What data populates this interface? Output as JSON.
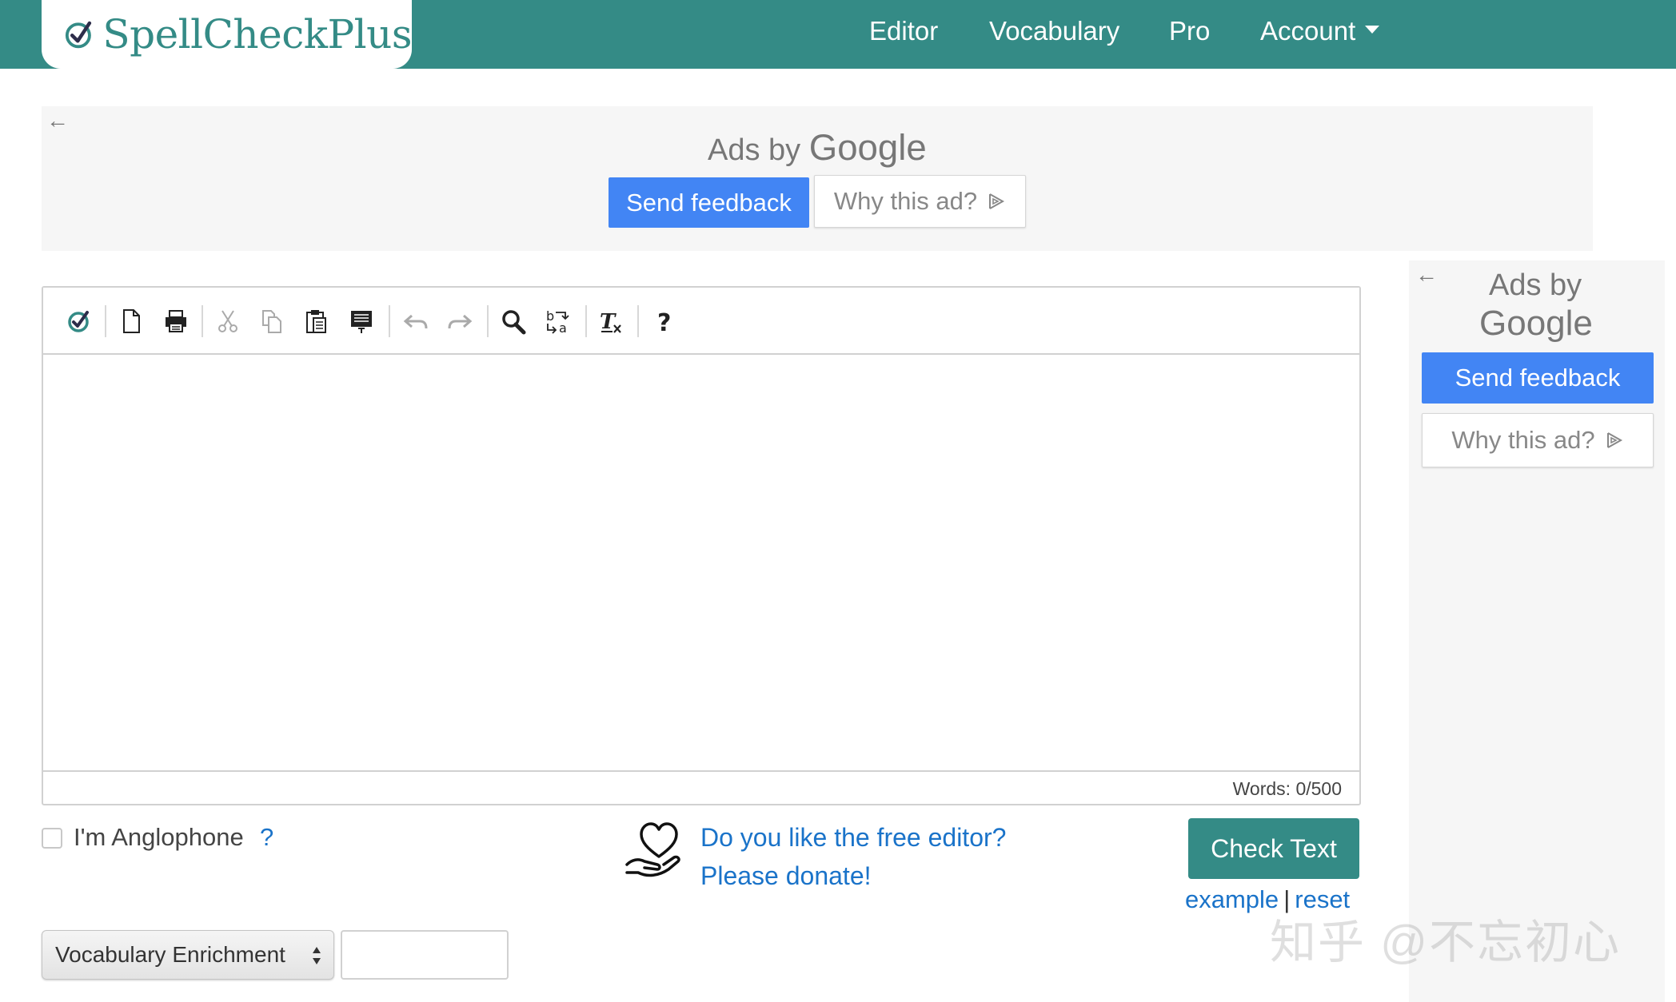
{
  "brand": {
    "name": "SpellCheckPlus",
    "color": "#348b86"
  },
  "nav": {
    "items": [
      "Editor",
      "Vocabulary",
      "Pro"
    ],
    "account_label": "Account"
  },
  "ad_top": {
    "back_arrow": "←",
    "ads_by": "Ads by ",
    "google": "Google",
    "feedback_label": "Send feedback",
    "why_label": "Why this ad?"
  },
  "ad_side": {
    "back_arrow": "←",
    "ads_by": "Ads by",
    "google": "Google",
    "feedback_label": "Send feedback",
    "why_label": "Why this ad?"
  },
  "toolbar": {
    "icons": [
      "spellcheck-icon",
      "new-document-icon",
      "print-icon",
      "cut-icon",
      "copy-icon",
      "paste-icon",
      "paste-text-icon",
      "undo-icon",
      "redo-icon",
      "find-icon",
      "replace-icon",
      "remove-format-icon",
      "help-icon"
    ]
  },
  "editor": {
    "words_label": "Words: 0/500"
  },
  "options": {
    "anglophone_label": "I'm Anglophone",
    "anglophone_help": "?",
    "anglophone_checked": false
  },
  "donate": {
    "line1": "Do you like the free editor?",
    "line2": "Please donate!"
  },
  "actions": {
    "check_label": "Check Text",
    "example_label": "example",
    "separator": "|",
    "reset_label": "reset"
  },
  "vocab": {
    "selected": "Vocabulary Enrichment",
    "input_value": ""
  },
  "watermark": "知乎 @不忘初心",
  "colors": {
    "nav_bg": "#348b86",
    "link": "#1a73c9",
    "ad_button": "#4285f4",
    "check_button": "#348b86"
  }
}
